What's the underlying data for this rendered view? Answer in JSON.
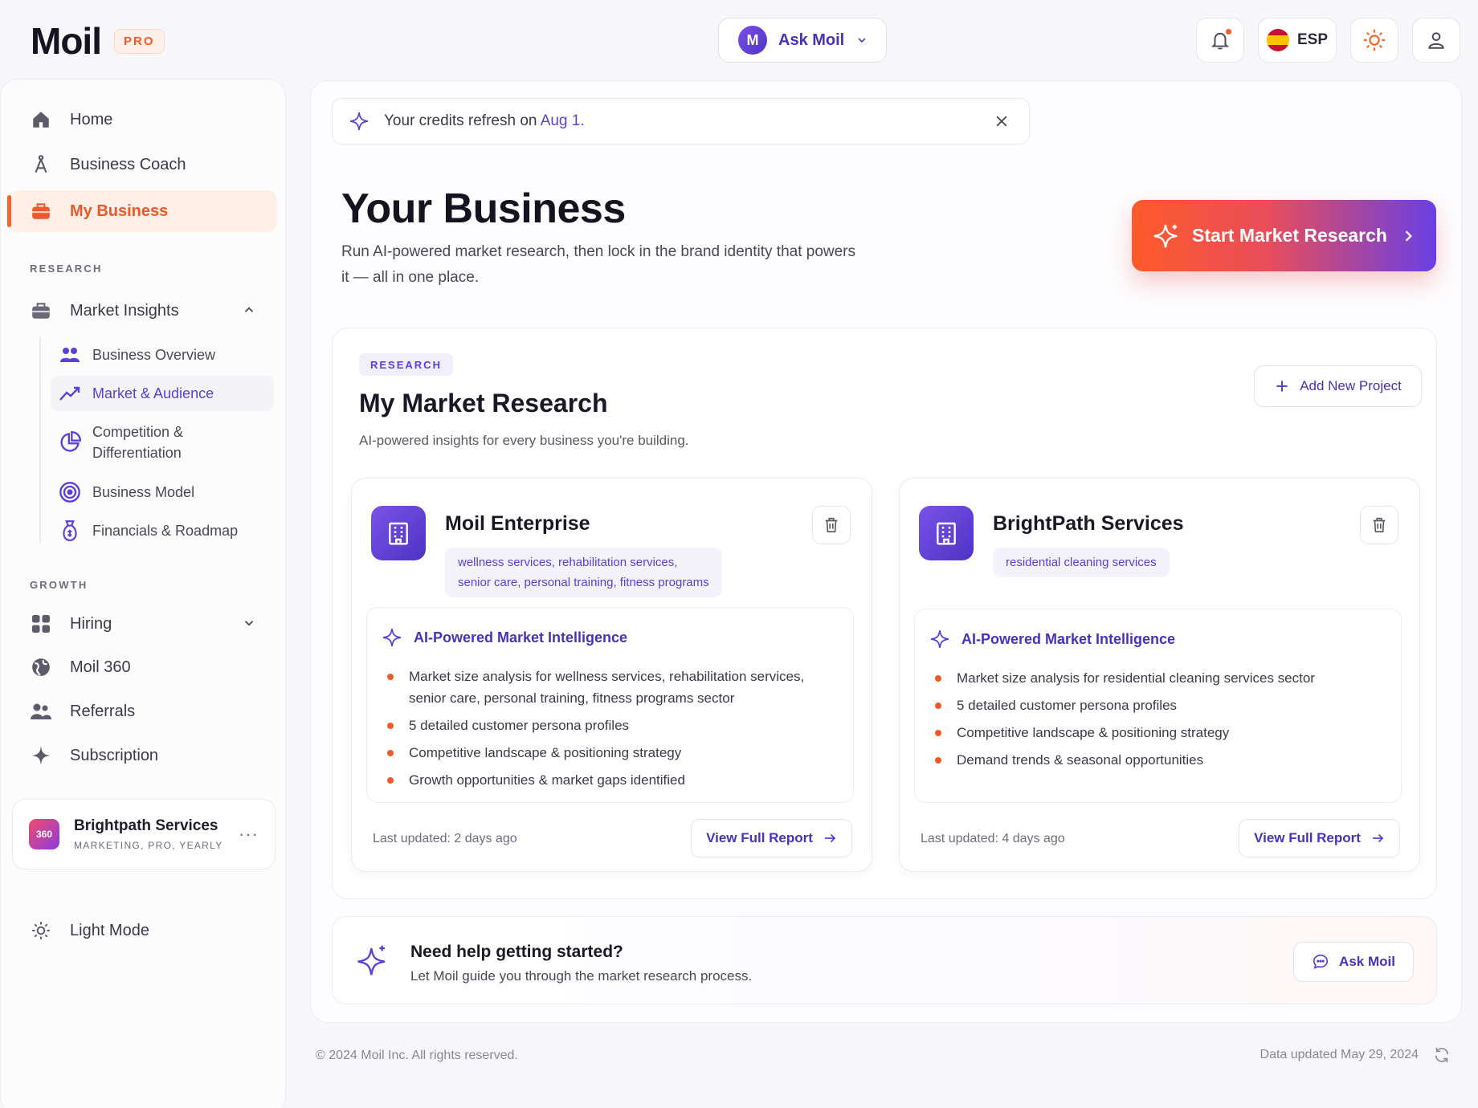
{
  "brand": {
    "logo_text": "Moil",
    "plan_badge": "PRO"
  },
  "topbar": {
    "ask": {
      "avatar_letter": "M",
      "label": "Ask Moil"
    },
    "language": "ESP"
  },
  "sidebar": {
    "primary": [
      {
        "label": "Home",
        "icon": "home-icon"
      },
      {
        "label": "Business Coach",
        "icon": "coach-icon"
      },
      {
        "label": "My Business",
        "icon": "briefcase-icon",
        "active": true
      }
    ],
    "research_label": "RESEARCH",
    "market_insights": {
      "label": "Market Insights",
      "items": [
        {
          "label": "Business Overview",
          "icon": "people-icon"
        },
        {
          "label": "Market & Audience",
          "icon": "trend-icon",
          "active": true
        },
        {
          "label": "Competition & Differentiation",
          "icon": "pie-chart-icon"
        },
        {
          "label": "Business Model",
          "icon": "target-icon"
        },
        {
          "label": "Financials & Roadmap",
          "icon": "finance-icon"
        }
      ]
    },
    "growth_label": "GROWTH",
    "growth": [
      {
        "label": "Hiring",
        "icon": "grid-icon"
      },
      {
        "label": "Moil 360",
        "icon": "globe-icon"
      },
      {
        "label": "Referrals",
        "icon": "users-icon"
      },
      {
        "label": "Subscription",
        "icon": "sparkle-icon"
      }
    ],
    "account": {
      "badge": "360",
      "name": "Brightpath Services",
      "meta": "MARKETING, PRO, YEARLY",
      "more": "···"
    },
    "theme_toggle": "Light Mode"
  },
  "credits_banner": {
    "prefix": "Your credits refresh on ",
    "date": "Aug 1",
    "suffix": "."
  },
  "hero": {
    "title": "Your Business",
    "subtitle": "Run AI-powered market research, then lock in the brand identity that powers it — all in one place.",
    "cta": "Start Market Research"
  },
  "research": {
    "tag": "RESEARCH",
    "title": "My Market Research",
    "subtitle": "AI-powered insights for every business you're building.",
    "add_button": "Add New Project",
    "projects": [
      {
        "name": "Moil Enterprise",
        "chips_line1": "wellness services, rehabilitation services,",
        "chips_line2": "senior care, personal training, fitness programs",
        "intel_title": "AI-Powered Market Intelligence",
        "bullets": [
          "Market size analysis for wellness services, rehabilitation services, senior care, personal training, fitness programs sector",
          "5 detailed customer persona profiles",
          "Competitive landscape & positioning strategy",
          "Growth opportunities & market gaps identified"
        ],
        "updated": "Last updated: 2 days ago",
        "view_button": "View Full Report"
      },
      {
        "name": "BrightPath Services",
        "chips_line1": "residential cleaning services",
        "intel_title": "AI-Powered Market Intelligence",
        "bullets": [
          "Market size analysis for residential cleaning services sector",
          "5 detailed customer persona profiles",
          "Competitive landscape & positioning strategy",
          "Demand trends & seasonal opportunities"
        ],
        "updated": "Last updated: 4 days ago",
        "view_button": "View Full Report"
      }
    ]
  },
  "help": {
    "title": "Need help getting started?",
    "subtitle": "Let Moil guide you through the market research process.",
    "button": "Ask Moil"
  },
  "footer": {
    "copyright": "© 2024 Moil Inc. All rights reserved.",
    "data_updated": "Data updated May 29, 2024"
  },
  "colors": {
    "accent": "#5b3fd6",
    "brand_orange": "#f0662f",
    "bullet": "#f05a2a"
  }
}
